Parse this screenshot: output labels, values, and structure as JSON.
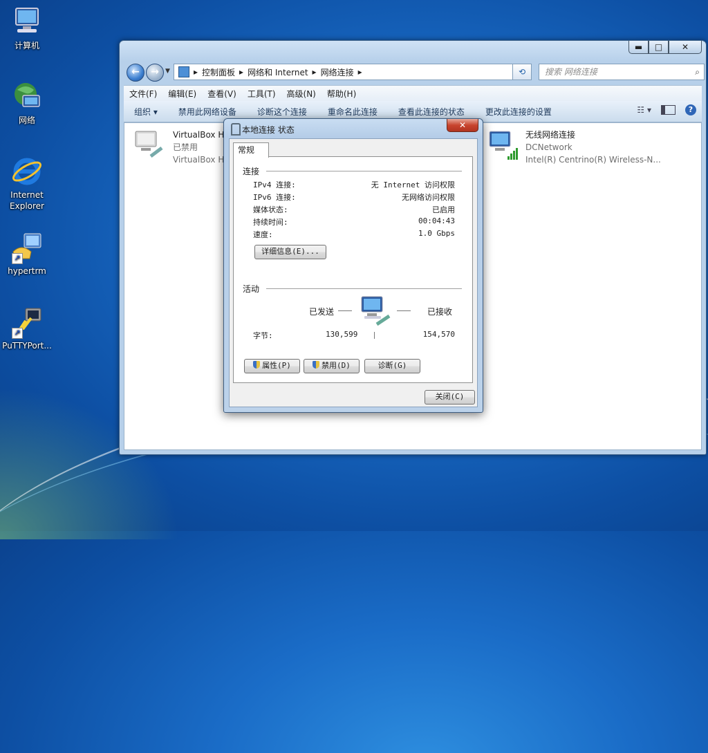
{
  "desktop": {
    "icons": [
      {
        "label": "计算机",
        "icon": "computer-icon"
      },
      {
        "label": "网络",
        "icon": "network-globe-icon"
      },
      {
        "label": "Internet Explorer",
        "icon": "internet-explorer-icon"
      },
      {
        "label": "hypertrm",
        "icon": "hyperterminal-icon"
      },
      {
        "label": "PuTTYPort...",
        "icon": "putty-icon"
      }
    ]
  },
  "explorer": {
    "caption_buttons": {
      "minimize": "▬",
      "maximize": "□",
      "close": "✕"
    },
    "breadcrumb": [
      "控制面板",
      "网络和 Internet",
      "网络连接"
    ],
    "search_placeholder": "搜索 网络连接",
    "menu": [
      "文件(F)",
      "编辑(E)",
      "查看(V)",
      "工具(T)",
      "高级(N)",
      "帮助(H)"
    ],
    "commands": [
      "组织 ▾",
      "禁用此网络设备",
      "诊断这个连接",
      "重命名此连接",
      "查看此连接的状态",
      "更改此连接的设置"
    ],
    "connections": [
      {
        "name": "VirtualBox H",
        "status": "已禁用",
        "device": "VirtualBox H",
        "icon": "wired-network-disabled-icon"
      },
      {
        "name": "无线网络连接",
        "status": "DCNetwork",
        "device": "Intel(R) Centrino(R) Wireless-N...",
        "icon": "wireless-network-icon"
      }
    ]
  },
  "dialog": {
    "title": "本地连接 状态",
    "tab": "常规",
    "connection_section": "连接",
    "rows": [
      {
        "label": "IPv4 连接:",
        "value": "无 Internet 访问权限"
      },
      {
        "label": "IPv6 连接:",
        "value": "无网络访问权限"
      },
      {
        "label": "媒体状态:",
        "value": "已启用"
      },
      {
        "label": "持续时间:",
        "value": "00:04:43"
      },
      {
        "label": "速度:",
        "value": "1.0 Gbps"
      }
    ],
    "details_button": "详细信息(E)...",
    "activity_section": "活动",
    "sent_label": "已发送",
    "received_label": "已接收",
    "bytes_label": "字节:",
    "bytes_sent": "130,599",
    "bytes_received": "154,570",
    "properties_button": "属性(P)",
    "disable_button": "禁用(D)",
    "diagnose_button": "诊断(G)",
    "close_button": "关闭(C)"
  }
}
